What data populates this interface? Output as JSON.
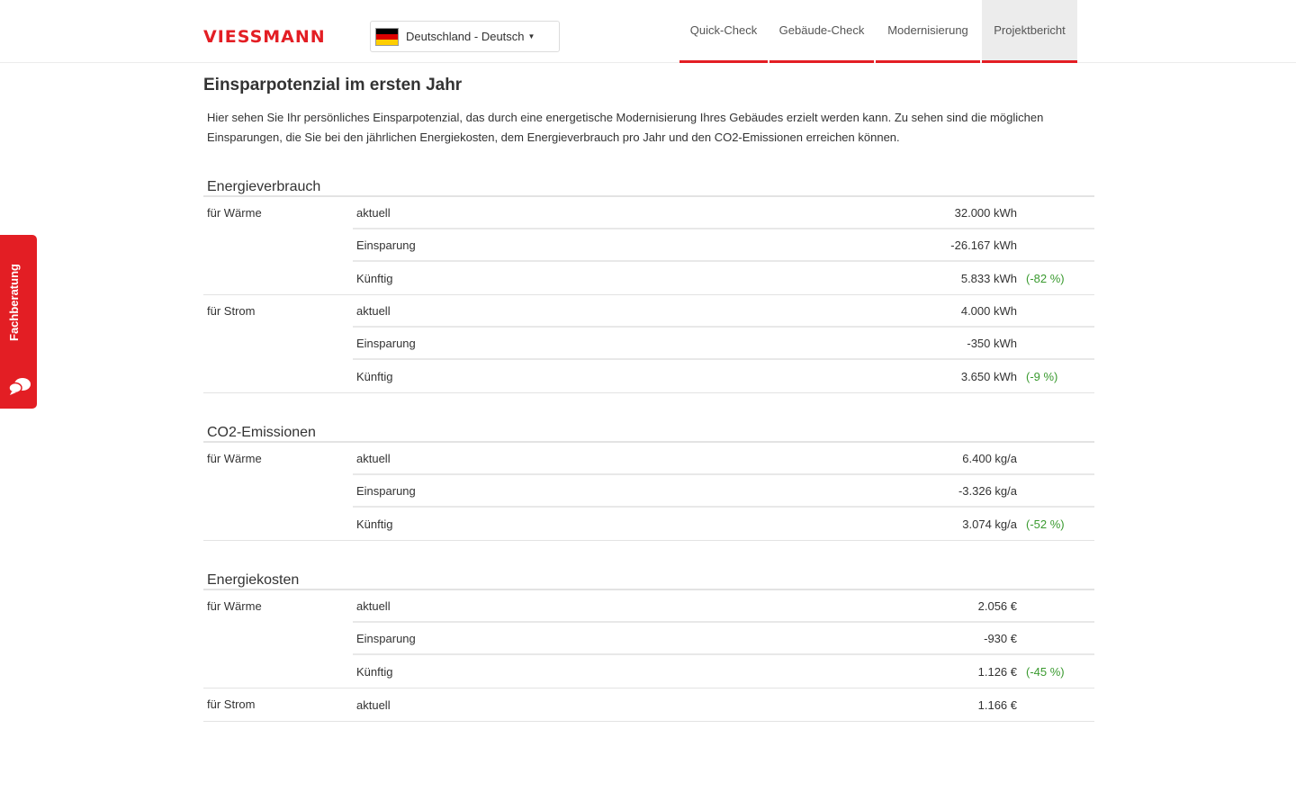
{
  "header": {
    "logo_text": "VIESSMANN",
    "language": "Deutschland - Deutsch",
    "nav": [
      {
        "label": "Quick-Check",
        "active": false
      },
      {
        "label": "Gebäude-Check",
        "active": false
      },
      {
        "label": "Modernisierung",
        "active": false
      },
      {
        "label": "Projektbericht",
        "active": true
      }
    ]
  },
  "side_tab": {
    "label": "Fachberatung",
    "icon": "chat-bubbles-icon"
  },
  "main": {
    "title": "Einsparpotenzial im ersten Jahr",
    "intro": "Hier sehen Sie Ihr persönliches Einsparpotenzial, das durch eine energetische Modernisierung Ihres Gebäudes erzielt werden kann. Zu sehen sind die möglichen Einsparungen, die Sie bei den jährlichen Energiekosten, dem Energieverbrauch pro Jahr und den CO2-Emissionen erreichen können.",
    "sections": [
      {
        "title": "Energieverbrauch",
        "groups": [
          {
            "label": "für Wärme",
            "rows": [
              {
                "label": "aktuell",
                "value": "32.000 kWh",
                "pct": ""
              },
              {
                "label": "Einsparung",
                "value": "-26.167 kWh",
                "pct": ""
              },
              {
                "label": "Künftig",
                "value": "5.833 kWh",
                "pct": "(-82 %)"
              }
            ]
          },
          {
            "label": "für Strom",
            "rows": [
              {
                "label": "aktuell",
                "value": "4.000 kWh",
                "pct": ""
              },
              {
                "label": "Einsparung",
                "value": "-350 kWh",
                "pct": ""
              },
              {
                "label": "Künftig",
                "value": "3.650 kWh",
                "pct": "(-9 %)"
              }
            ]
          }
        ]
      },
      {
        "title": "CO2-Emissionen",
        "groups": [
          {
            "label": "für Wärme",
            "rows": [
              {
                "label": "aktuell",
                "value": "6.400 kg/a",
                "pct": ""
              },
              {
                "label": "Einsparung",
                "value": "-3.326 kg/a",
                "pct": ""
              },
              {
                "label": "Künftig",
                "value": "3.074 kg/a",
                "pct": "(-52 %)"
              }
            ]
          }
        ]
      },
      {
        "title": "Energiekosten",
        "groups": [
          {
            "label": "für Wärme",
            "rows": [
              {
                "label": "aktuell",
                "value": "2.056 €",
                "pct": ""
              },
              {
                "label": "Einsparung",
                "value": "-930 €",
                "pct": ""
              },
              {
                "label": "Künftig",
                "value": "1.126 €",
                "pct": "(-45 %)"
              }
            ]
          },
          {
            "label": "für Strom",
            "rows": [
              {
                "label": "aktuell",
                "value": "1.166 €",
                "pct": ""
              }
            ]
          }
        ]
      }
    ]
  },
  "colors": {
    "brand_red": "#e31e24",
    "savings_green": "#3a9a2f"
  }
}
